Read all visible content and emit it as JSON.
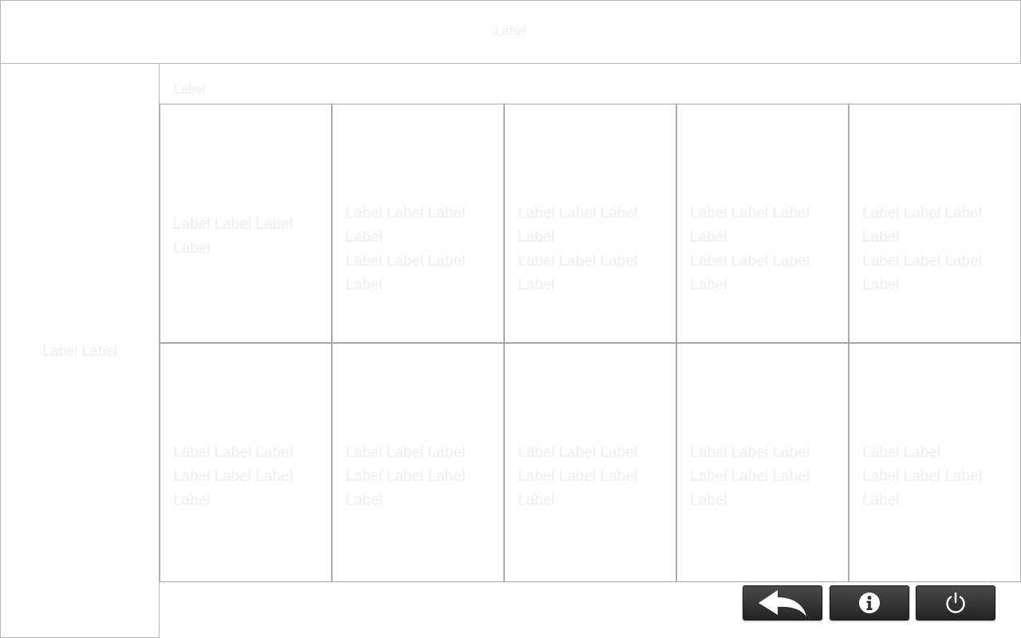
{
  "header": {
    "title": "Label"
  },
  "sidebar": {
    "label": "Label Label"
  },
  "section": {
    "label": "Label"
  },
  "tiles": [
    {
      "text": "Label Label Label Label"
    },
    {
      "text": "Label Label Label Label\nLabel Label Label Label"
    },
    {
      "text": "Label Label Label Label\nLabel Label Label Label"
    },
    {
      "text": "Label Label Label Label\nLabel Label Label Label"
    },
    {
      "text": "Label Label Label Label\nLabel Label Label Label"
    },
    {
      "text": "Label Label Label\nLabel Label Label Label"
    },
    {
      "text": "Label Label Label\nLabel Label Label Label"
    },
    {
      "text": "Label Label Label\nLabel Label Label Label"
    },
    {
      "text": "Label Label Label\nLabel Label Label Label"
    },
    {
      "text": "Label Label\nLabel Label Label Label"
    }
  ],
  "footer": {
    "buttons": [
      {
        "icon": "back-arrow-icon"
      },
      {
        "icon": "info-icon"
      },
      {
        "icon": "power-icon"
      }
    ]
  }
}
